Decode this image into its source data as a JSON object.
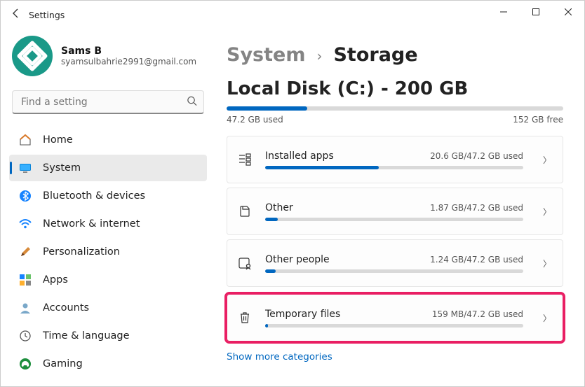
{
  "window": {
    "title": "Settings"
  },
  "user": {
    "name": "Sams B",
    "email": "syamsulbahrie2991@gmail.com"
  },
  "search": {
    "placeholder": "Find a setting"
  },
  "nav": {
    "home": "Home",
    "system": "System",
    "bluetooth": "Bluetooth & devices",
    "network": "Network & internet",
    "personalization": "Personalization",
    "apps": "Apps",
    "accounts": "Accounts",
    "time": "Time & language",
    "gaming": "Gaming"
  },
  "breadcrumb": {
    "root": "System",
    "current": "Storage"
  },
  "disk": {
    "title": "Local Disk (C:) - 200 GB",
    "used": "47.2 GB used",
    "free": "152 GB free",
    "usedPercent": 24
  },
  "cards": {
    "installed": {
      "title": "Installed apps",
      "meta": "20.6 GB/47.2 GB used",
      "percent": 44
    },
    "other": {
      "title": "Other",
      "meta": "1.87 GB/47.2 GB used",
      "percent": 5
    },
    "people": {
      "title": "Other people",
      "meta": "1.24 GB/47.2 GB used",
      "percent": 4
    },
    "temp": {
      "title": "Temporary files",
      "meta": "159 MB/47.2 GB used",
      "percent": 1
    }
  },
  "link": {
    "showMore": "Show more categories"
  },
  "colors": {
    "accent": "#0067c0",
    "highlight": "#e91e63"
  },
  "chart_data": {
    "type": "bar",
    "title": "Local Disk (C:) - 200 GB",
    "categories": [
      "Used",
      "Free"
    ],
    "values": [
      47.2,
      152
    ],
    "series": [
      {
        "name": "Installed apps",
        "used_gb": 20.6,
        "total_gb": 47.2
      },
      {
        "name": "Other",
        "used_gb": 1.87,
        "total_gb": 47.2
      },
      {
        "name": "Other people",
        "used_gb": 1.24,
        "total_gb": 47.2
      },
      {
        "name": "Temporary files",
        "used_gb": 0.159,
        "total_gb": 47.2
      }
    ],
    "xlabel": "",
    "ylabel": "GB"
  }
}
